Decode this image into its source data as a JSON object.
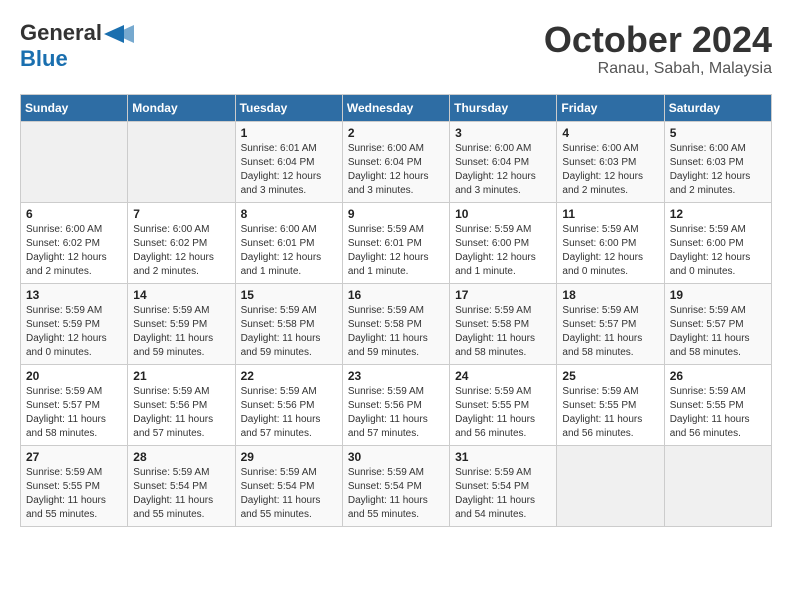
{
  "header": {
    "logo_general": "General",
    "logo_blue": "Blue",
    "month": "October 2024",
    "location": "Ranau, Sabah, Malaysia"
  },
  "days_of_week": [
    "Sunday",
    "Monday",
    "Tuesday",
    "Wednesday",
    "Thursday",
    "Friday",
    "Saturday"
  ],
  "weeks": [
    [
      {
        "day": "",
        "info": ""
      },
      {
        "day": "",
        "info": ""
      },
      {
        "day": "1",
        "info": "Sunrise: 6:01 AM\nSunset: 6:04 PM\nDaylight: 12 hours and 3 minutes."
      },
      {
        "day": "2",
        "info": "Sunrise: 6:00 AM\nSunset: 6:04 PM\nDaylight: 12 hours and 3 minutes."
      },
      {
        "day": "3",
        "info": "Sunrise: 6:00 AM\nSunset: 6:04 PM\nDaylight: 12 hours and 3 minutes."
      },
      {
        "day": "4",
        "info": "Sunrise: 6:00 AM\nSunset: 6:03 PM\nDaylight: 12 hours and 2 minutes."
      },
      {
        "day": "5",
        "info": "Sunrise: 6:00 AM\nSunset: 6:03 PM\nDaylight: 12 hours and 2 minutes."
      }
    ],
    [
      {
        "day": "6",
        "info": "Sunrise: 6:00 AM\nSunset: 6:02 PM\nDaylight: 12 hours and 2 minutes."
      },
      {
        "day": "7",
        "info": "Sunrise: 6:00 AM\nSunset: 6:02 PM\nDaylight: 12 hours and 2 minutes."
      },
      {
        "day": "8",
        "info": "Sunrise: 6:00 AM\nSunset: 6:01 PM\nDaylight: 12 hours and 1 minute."
      },
      {
        "day": "9",
        "info": "Sunrise: 5:59 AM\nSunset: 6:01 PM\nDaylight: 12 hours and 1 minute."
      },
      {
        "day": "10",
        "info": "Sunrise: 5:59 AM\nSunset: 6:00 PM\nDaylight: 12 hours and 1 minute."
      },
      {
        "day": "11",
        "info": "Sunrise: 5:59 AM\nSunset: 6:00 PM\nDaylight: 12 hours and 0 minutes."
      },
      {
        "day": "12",
        "info": "Sunrise: 5:59 AM\nSunset: 6:00 PM\nDaylight: 12 hours and 0 minutes."
      }
    ],
    [
      {
        "day": "13",
        "info": "Sunrise: 5:59 AM\nSunset: 5:59 PM\nDaylight: 12 hours and 0 minutes."
      },
      {
        "day": "14",
        "info": "Sunrise: 5:59 AM\nSunset: 5:59 PM\nDaylight: 11 hours and 59 minutes."
      },
      {
        "day": "15",
        "info": "Sunrise: 5:59 AM\nSunset: 5:58 PM\nDaylight: 11 hours and 59 minutes."
      },
      {
        "day": "16",
        "info": "Sunrise: 5:59 AM\nSunset: 5:58 PM\nDaylight: 11 hours and 59 minutes."
      },
      {
        "day": "17",
        "info": "Sunrise: 5:59 AM\nSunset: 5:58 PM\nDaylight: 11 hours and 58 minutes."
      },
      {
        "day": "18",
        "info": "Sunrise: 5:59 AM\nSunset: 5:57 PM\nDaylight: 11 hours and 58 minutes."
      },
      {
        "day": "19",
        "info": "Sunrise: 5:59 AM\nSunset: 5:57 PM\nDaylight: 11 hours and 58 minutes."
      }
    ],
    [
      {
        "day": "20",
        "info": "Sunrise: 5:59 AM\nSunset: 5:57 PM\nDaylight: 11 hours and 58 minutes."
      },
      {
        "day": "21",
        "info": "Sunrise: 5:59 AM\nSunset: 5:56 PM\nDaylight: 11 hours and 57 minutes."
      },
      {
        "day": "22",
        "info": "Sunrise: 5:59 AM\nSunset: 5:56 PM\nDaylight: 11 hours and 57 minutes."
      },
      {
        "day": "23",
        "info": "Sunrise: 5:59 AM\nSunset: 5:56 PM\nDaylight: 11 hours and 57 minutes."
      },
      {
        "day": "24",
        "info": "Sunrise: 5:59 AM\nSunset: 5:55 PM\nDaylight: 11 hours and 56 minutes."
      },
      {
        "day": "25",
        "info": "Sunrise: 5:59 AM\nSunset: 5:55 PM\nDaylight: 11 hours and 56 minutes."
      },
      {
        "day": "26",
        "info": "Sunrise: 5:59 AM\nSunset: 5:55 PM\nDaylight: 11 hours and 56 minutes."
      }
    ],
    [
      {
        "day": "27",
        "info": "Sunrise: 5:59 AM\nSunset: 5:55 PM\nDaylight: 11 hours and 55 minutes."
      },
      {
        "day": "28",
        "info": "Sunrise: 5:59 AM\nSunset: 5:54 PM\nDaylight: 11 hours and 55 minutes."
      },
      {
        "day": "29",
        "info": "Sunrise: 5:59 AM\nSunset: 5:54 PM\nDaylight: 11 hours and 55 minutes."
      },
      {
        "day": "30",
        "info": "Sunrise: 5:59 AM\nSunset: 5:54 PM\nDaylight: 11 hours and 55 minutes."
      },
      {
        "day": "31",
        "info": "Sunrise: 5:59 AM\nSunset: 5:54 PM\nDaylight: 11 hours and 54 minutes."
      },
      {
        "day": "",
        "info": ""
      },
      {
        "day": "",
        "info": ""
      }
    ]
  ]
}
